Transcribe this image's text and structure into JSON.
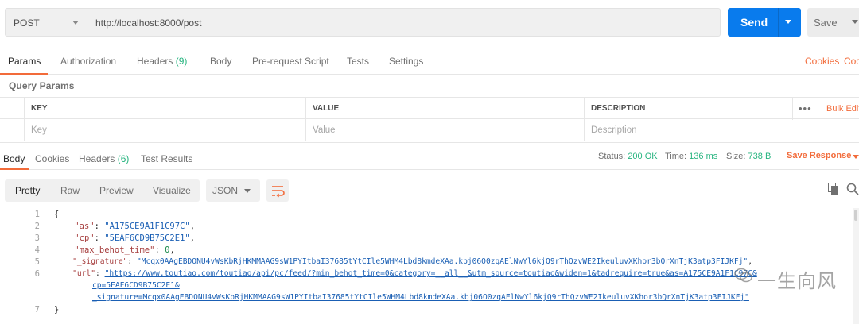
{
  "request": {
    "method": "POST",
    "url": "http://localhost:8000/post",
    "send_label": "Send",
    "save_label": "Save"
  },
  "request_tabs": {
    "params": "Params",
    "authorization": "Authorization",
    "headers_label": "Headers",
    "headers_count": "(9)",
    "body": "Body",
    "prerequest": "Pre-request Script",
    "tests": "Tests",
    "settings": "Settings",
    "cookies": "Cookies",
    "code": "Code"
  },
  "query_params": {
    "title": "Query Params",
    "columns": [
      "KEY",
      "VALUE",
      "DESCRIPTION"
    ],
    "placeholders": [
      "Key",
      "Value",
      "Description"
    ],
    "more": "•••",
    "bulk_edit": "Bulk Edit"
  },
  "response_tabs": {
    "body": "Body",
    "cookies": "Cookies",
    "headers_label": "Headers",
    "headers_count": "(6)",
    "test_results": "Test Results",
    "status_label": "Status:",
    "status_value": "200 OK",
    "time_label": "Time:",
    "time_value": "136 ms",
    "size_label": "Size:",
    "size_value": "738 B",
    "save_response": "Save Response"
  },
  "view": {
    "options": [
      "Pretty",
      "Raw",
      "Preview",
      "Visualize"
    ],
    "active": "Pretty",
    "format": "JSON"
  },
  "code": {
    "line_numbers": [
      "1",
      "2",
      "3",
      "4",
      "5",
      "6",
      "7"
    ],
    "open_brace": "{",
    "close_brace": "}",
    "as_key": "\"as\"",
    "as_val": "\"A175CE9A1F1C97C\"",
    "cp_key": "\"cp\"",
    "cp_val": "\"5EAF6CD9B75C2E1\"",
    "mbt_key": "\"max_behot_time\"",
    "mbt_val": "0",
    "sig_key": "\"_signature\"",
    "sig_val": "\"Mcqx0AAgEBDONU4vWsKbRjHKMMAAG9sW1PYItbaI37685tYtCIle5WHM4Lbd8kmdeXAa.kbj06O0zqAElNwYl6kjQ9rThQzvWE2IkeuluvXKhor3bQrXnTjK3atp3FIJKFj\"",
    "url_key": "\"url\"",
    "url_val_1": "\"https://www.toutiao.com/toutiao/api/pc/feed/?min_behot_time=0&category=__all__&utm_source=toutiao&widen=1&tadrequire=true&as=A175CE9A1F1C97C&",
    "url_val_2": "cp=5EAF6CD9B75C2E1&",
    "url_val_3": "_signature=Mcqx0AAgEBDONU4vWsKbRjHKMMAAG9sW1PYItbaI37685tYtCIle5WHM4Lbd8kmdeXAa.kbj06O0zqAElNwYl6kjQ9rThQzvWE2IkeuluvXKhor3bQrXnTjK3atp3FIJKFj\""
  },
  "watermark": "一生向风",
  "colors": {
    "accent": "#f26b3a",
    "send": "#097bed",
    "success": "#26b47f"
  }
}
